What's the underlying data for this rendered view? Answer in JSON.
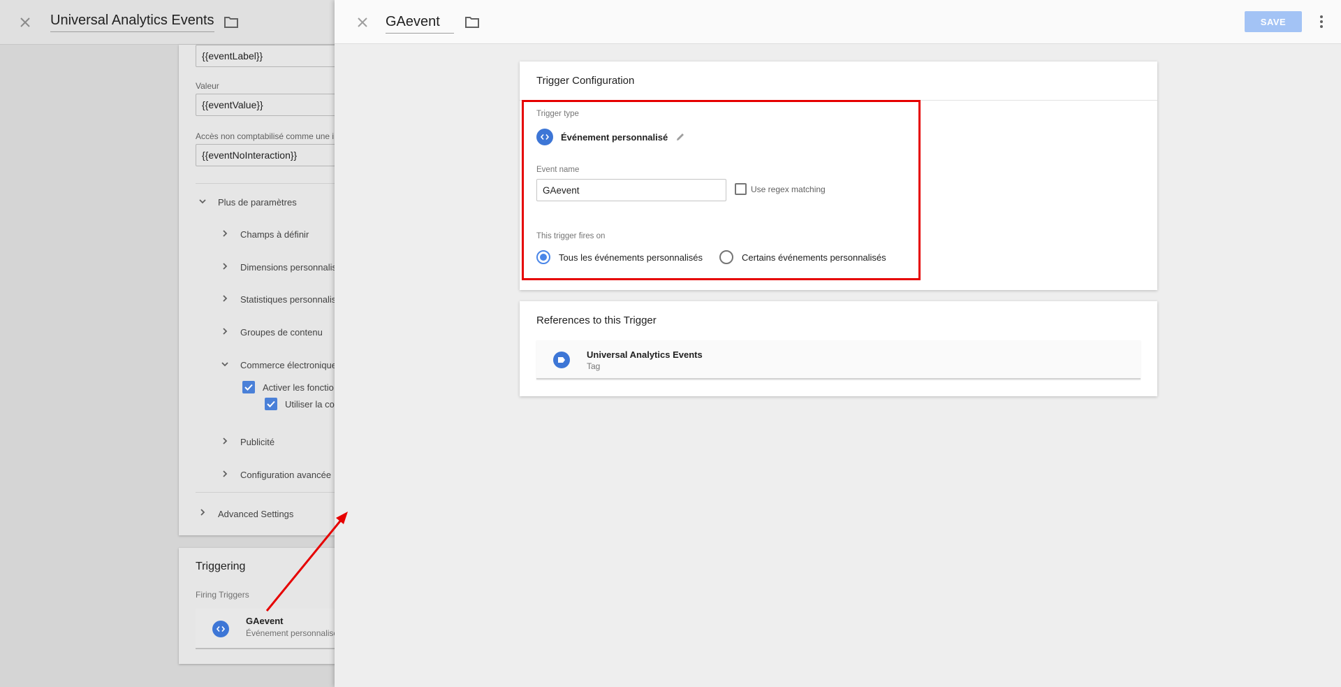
{
  "background": {
    "title": "Universal Analytics Events",
    "fields": {
      "event_label_value": "{{eventLabel}}",
      "value_label": "Valeur",
      "value_value": "{{eventValue}}",
      "non_interaction_label": "Accès non comptabilisé comme une i",
      "non_interaction_value": "{{eventNoInteraction}}"
    },
    "more_settings": "Plus de paramètres",
    "sections": [
      "Champs à définir",
      "Dimensions personnalis",
      "Statistiques personnalis",
      "Groupes de contenu",
      "Commerce électronique"
    ],
    "ecommerce_options": [
      "Activer les fonctio",
      "Utiliser la co"
    ],
    "sections_after": [
      "Publicité",
      "Configuration avancée"
    ],
    "advanced_settings": "Advanced Settings",
    "triggering": {
      "title": "Triggering",
      "subtitle": "Firing Triggers",
      "item_name": "GAevent",
      "item_type": "Événement personnalisé"
    }
  },
  "panel": {
    "title": "GAevent",
    "save_label": "SAVE",
    "trigger_config": {
      "title": "Trigger Configuration",
      "type_label": "Trigger type",
      "type_name": "Événement personnalisé",
      "event_name_label": "Event name",
      "event_name_value": "GAevent",
      "regex_label": "Use regex matching",
      "fires_on_label": "This trigger fires on",
      "option_all": "Tous les événements personnalisés",
      "option_some": "Certains événements personnalisés"
    },
    "references": {
      "title": "References to this Trigger",
      "item_name": "Universal Analytics Events",
      "item_type": "Tag"
    }
  },
  "colors": {
    "accent": "#4a86e8",
    "save_disabled": "#a3c3f5",
    "highlight": "#e60000"
  }
}
